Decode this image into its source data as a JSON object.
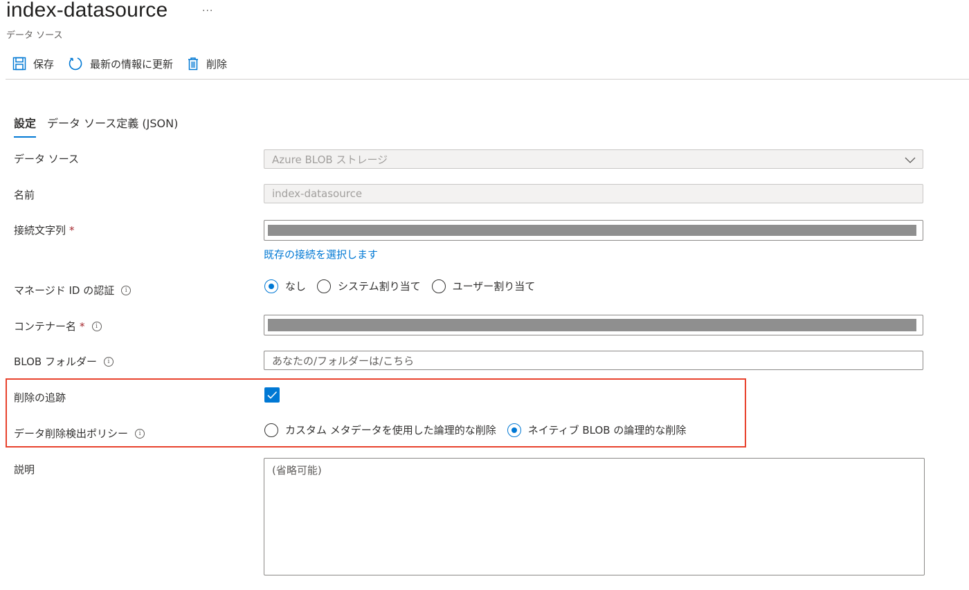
{
  "header": {
    "title": "index-datasource",
    "more": "···",
    "subtitle": "データ ソース"
  },
  "toolbar": {
    "save_label": "保存",
    "refresh_label": "最新の情報に更新",
    "delete_label": "削除"
  },
  "tabs": [
    {
      "label": "設定",
      "active": true
    },
    {
      "label": "データ ソース定義 (JSON)",
      "active": false
    }
  ],
  "form": {
    "datasource": {
      "label": "データ ソース",
      "value": "Azure BLOB ストレージ"
    },
    "name": {
      "label": "名前",
      "value": "index-datasource"
    },
    "connection_string": {
      "label": "接続文字列",
      "required_mark": "*",
      "value": "",
      "link": "既存の接続を選択します"
    },
    "managed_id": {
      "label": "マネージド ID の認証",
      "info": "i",
      "options": [
        "なし",
        "システム割り当て",
        "ユーザー割り当て"
      ],
      "selected": "なし"
    },
    "container": {
      "label": "コンテナー名",
      "required_mark": "*",
      "info": "i",
      "value": ""
    },
    "blob_folder": {
      "label": "BLOB フォルダー",
      "info": "i",
      "placeholder": "あなたの/フォルダーは/こちら"
    },
    "track_deletion": {
      "label": "削除の追跡",
      "checked": true
    },
    "deletion_policy": {
      "label": "データ削除検出ポリシー",
      "info": "i",
      "options": [
        "カスタム メタデータを使用した論理的な削除",
        "ネイティブ BLOB の論理的な削除"
      ],
      "selected": "ネイティブ BLOB の論理的な削除"
    },
    "description": {
      "label": "説明",
      "placeholder": "(省略可能)"
    }
  },
  "colors": {
    "accent": "#0078d4",
    "highlight": "#e8412c",
    "required": "#a4262c"
  }
}
